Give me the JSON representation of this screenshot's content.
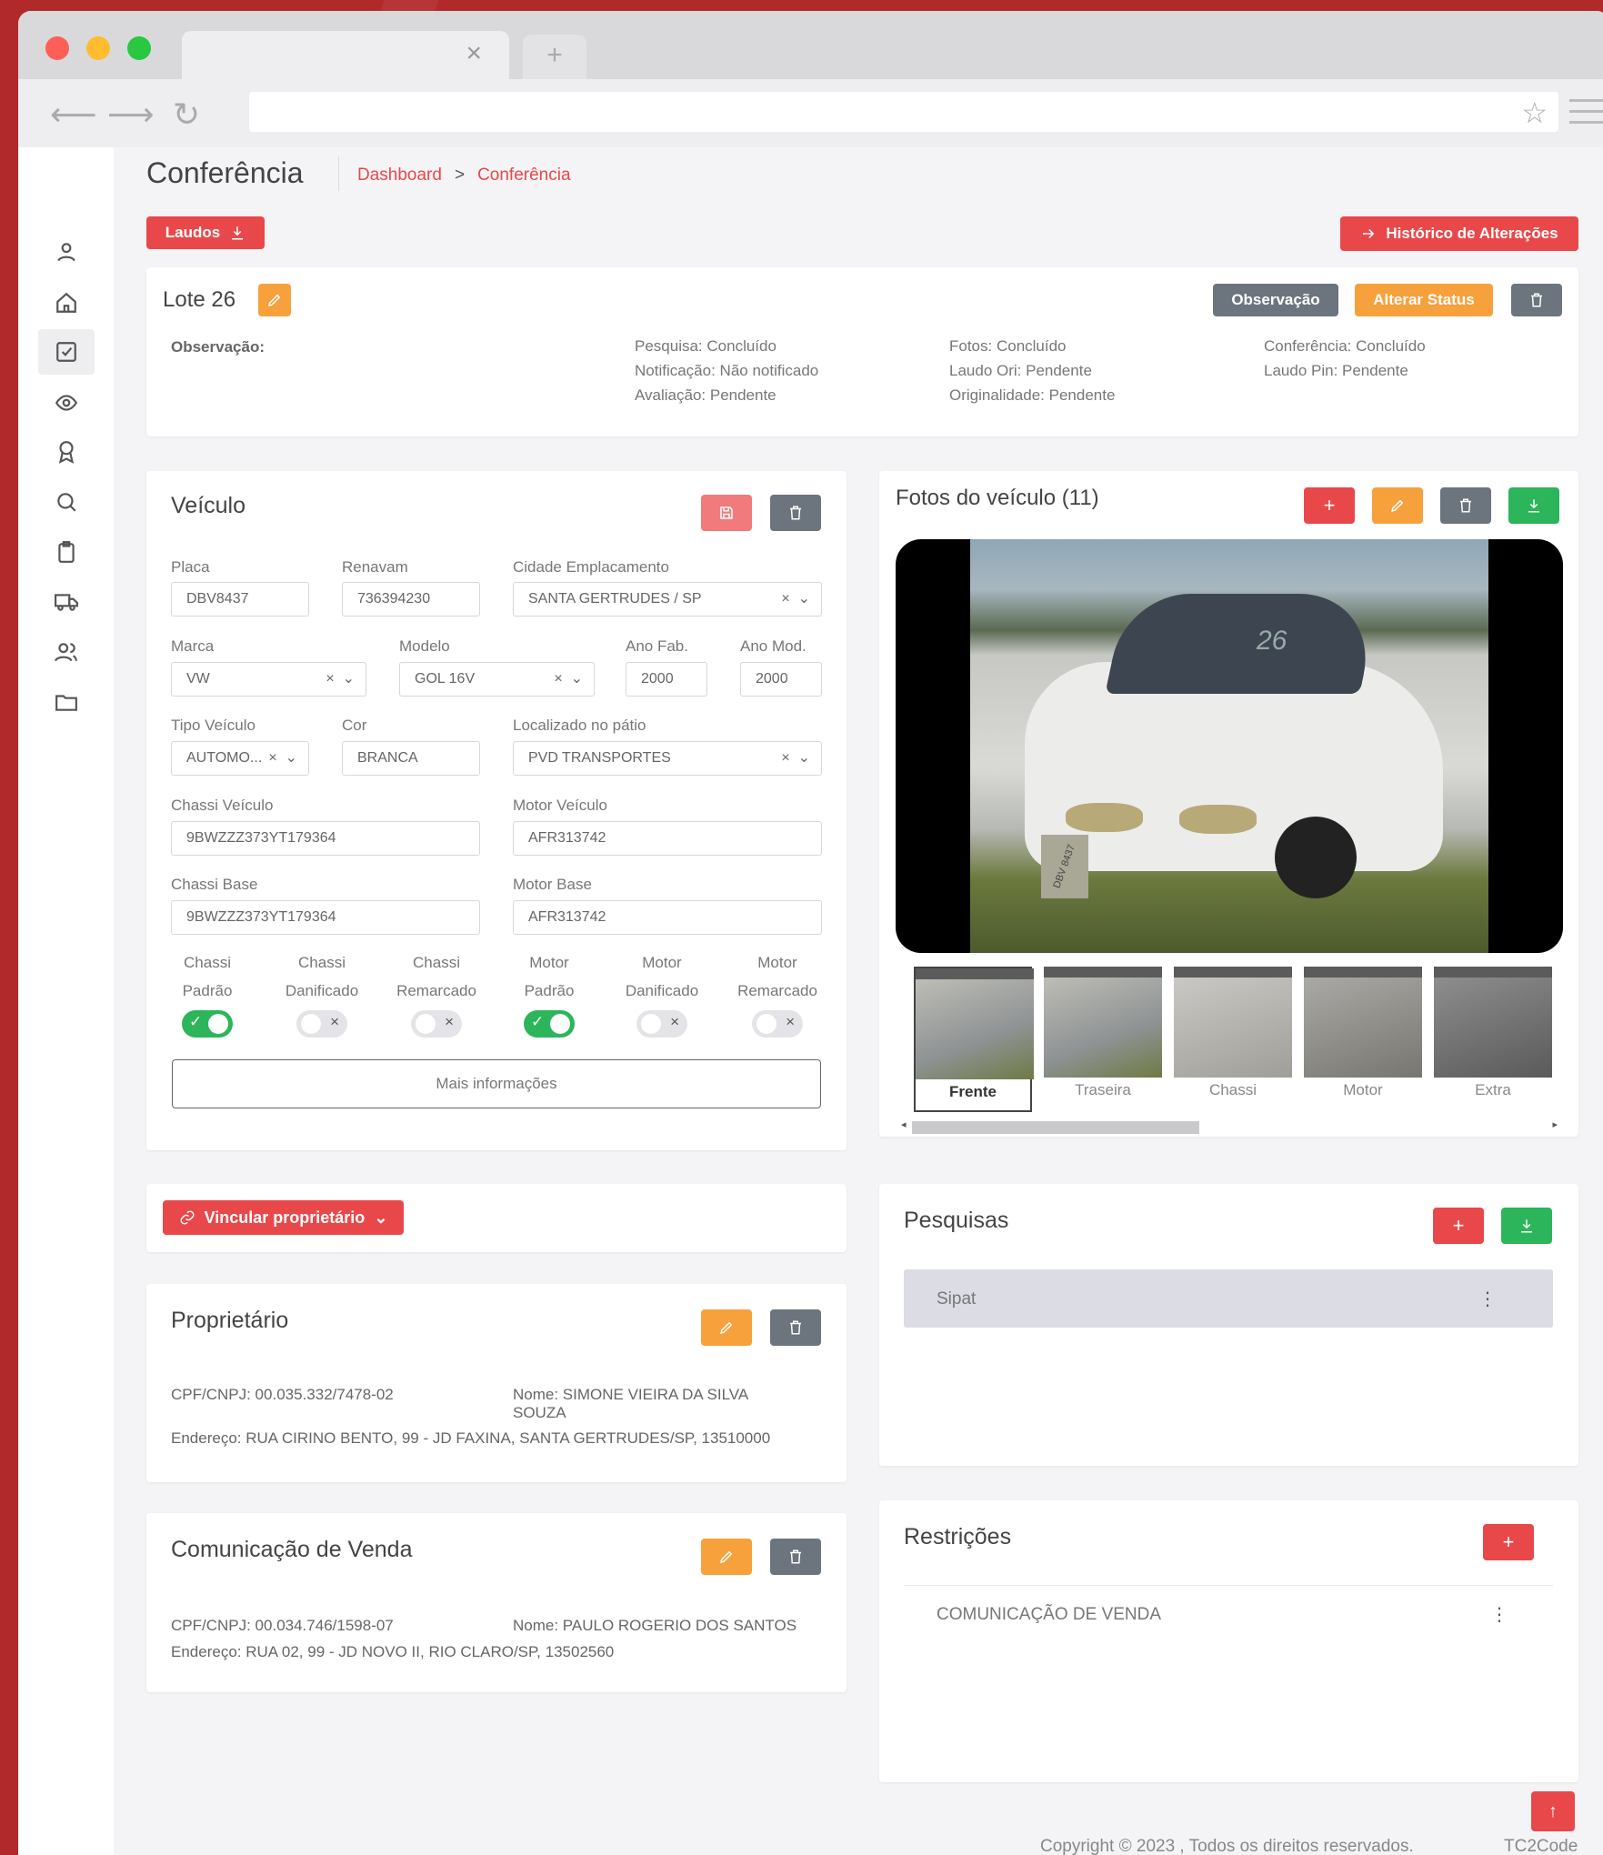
{
  "page": {
    "title": "Conferência",
    "breadcrumb": [
      "Dashboard",
      "Conferência"
    ],
    "breadcrumb_sep": ">"
  },
  "browser": {
    "close": "×",
    "new_tab": "+"
  },
  "toolbar": {
    "laudos_label": "Laudos",
    "historico_label": "Histórico de Alterações"
  },
  "lote": {
    "title": "Lote 26",
    "observacao_label": "Observação:",
    "buttons": {
      "observacao": "Observação",
      "alterar_status": "Alterar Status"
    },
    "status_col1": [
      "Pesquisa: Concluído",
      "Notificação: Não notificado",
      "Avaliação: Pendente"
    ],
    "status_col2": [
      "Fotos: Concluído",
      "Laudo Ori: Pendente",
      "Originalidade: Pendente"
    ],
    "status_col3": [
      "Conferência: Concluído",
      "Laudo Pin: Pendente"
    ]
  },
  "veiculo": {
    "title": "Veículo",
    "fields": {
      "placa": {
        "label": "Placa",
        "value": "DBV8437"
      },
      "renavam": {
        "label": "Renavam",
        "value": "736394230"
      },
      "cidade": {
        "label": "Cidade Emplacamento",
        "value": "SANTA GERTRUDES / SP"
      },
      "marca": {
        "label": "Marca",
        "value": "VW"
      },
      "modelo": {
        "label": "Modelo",
        "value": "GOL 16V"
      },
      "ano_fab": {
        "label": "Ano Fab.",
        "value": "2000"
      },
      "ano_mod": {
        "label": "Ano Mod.",
        "value": "2000"
      },
      "tipo": {
        "label": "Tipo Veículo",
        "value": "AUTOMO..."
      },
      "cor": {
        "label": "Cor",
        "value": "BRANCA"
      },
      "patio": {
        "label": "Localizado no pátio",
        "value": "PVD TRANSPORTES"
      },
      "chassi_veiculo": {
        "label": "Chassi Veículo",
        "value": "9BWZZZ373YT179364"
      },
      "motor_veiculo": {
        "label": "Motor Veículo",
        "value": "AFR313742"
      },
      "chassi_base": {
        "label": "Chassi Base",
        "value": "9BWZZZ373YT179364"
      },
      "motor_base": {
        "label": "Motor Base",
        "value": "AFR313742"
      }
    },
    "select_clear": "×",
    "select_caret": "⌄",
    "toggles": [
      {
        "line1": "Chassi",
        "line2": "Padrão",
        "on": true
      },
      {
        "line1": "Chassi",
        "line2": "Danificado",
        "on": false
      },
      {
        "line1": "Chassi",
        "line2": "Remarcado",
        "on": false
      },
      {
        "line1": "Motor",
        "line2": "Padrão",
        "on": true
      },
      {
        "line1": "Motor",
        "line2": "Danificado",
        "on": false
      },
      {
        "line1": "Motor",
        "line2": "Remarcado",
        "on": false
      }
    ],
    "toggle_on_mark": "✓",
    "toggle_off_mark": "×",
    "mais_info": "Mais informações"
  },
  "fotos": {
    "title": "Fotos do veículo (11)",
    "plus": "+",
    "plate_text": "DBV 8437",
    "windshield_text": "26",
    "thumbnails": [
      "Frente",
      "Traseira",
      "Chassi",
      "Motor",
      "Extra"
    ],
    "scroll_left": "◂",
    "scroll_right": "▸"
  },
  "vincular": {
    "label": "Vincular proprietário",
    "caret": "⌄"
  },
  "proprietario": {
    "title": "Proprietário",
    "cpf": "CPF/CNPJ: 00.035.332/7478-02",
    "nome": "Nome: SIMONE VIEIRA DA SILVA SOUZA",
    "endereco": "Endereço: RUA CIRINO BENTO, 99 - JD FAXINA, SANTA GERTRUDES/SP, 13510000"
  },
  "comunicacao": {
    "title": "Comunicação de Venda",
    "cpf": "CPF/CNPJ: 00.034.746/1598-07",
    "nome": "Nome: PAULO ROGERIO DOS SANTOS",
    "endereco": "Endereço: RUA 02, 99 - JD NOVO II, RIO CLARO/SP, 13502560"
  },
  "pesquisas": {
    "title": "Pesquisas",
    "plus": "+",
    "items": [
      "Sipat"
    ],
    "menu": "⋮"
  },
  "restricoes": {
    "title": "Restrições",
    "plus": "+",
    "items": [
      "COMUNICAÇÃO DE VENDA"
    ],
    "menu": "⋮"
  },
  "footer": {
    "copyright": "Copyright © 2023 , Todos os direitos reservados.",
    "brand": "TC2Code",
    "top": "↑"
  },
  "colors": {
    "accent": "#e9484a",
    "orange": "#f7a13c",
    "gray": "#6c757d",
    "green": "#2cb55a",
    "background": "#b2292b"
  }
}
